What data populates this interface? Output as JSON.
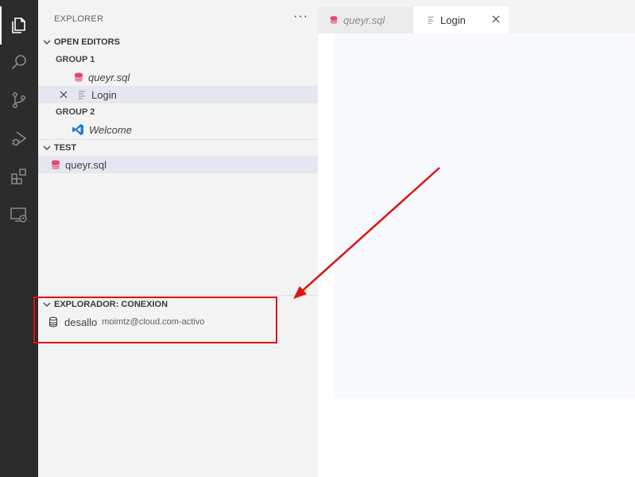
{
  "activity_bar": {
    "items": [
      {
        "name": "explorer",
        "icon": "files-icon",
        "active": true
      },
      {
        "name": "search",
        "icon": "search-icon"
      },
      {
        "name": "source-control",
        "icon": "source-control-icon"
      },
      {
        "name": "run-debug",
        "icon": "run-debug-icon"
      },
      {
        "name": "extensions",
        "icon": "extensions-icon"
      },
      {
        "name": "remote-explorer",
        "icon": "remote-explorer-icon"
      }
    ]
  },
  "sidebar": {
    "title": "EXPLORER",
    "more": "···",
    "open_editors": {
      "label": "OPEN EDITORS",
      "group1": {
        "label": "GROUP 1",
        "items": [
          {
            "label": "queyr.sql",
            "icon": "database-icon"
          },
          {
            "label": "Login",
            "icon": "file-text-icon"
          }
        ]
      },
      "group2": {
        "label": "GROUP 2",
        "items": [
          {
            "label": "Welcome",
            "icon": "vscode-logo-icon"
          }
        ]
      }
    },
    "test": {
      "label": "TEST",
      "items": [
        {
          "label": "queyr.sql",
          "icon": "database-icon"
        }
      ]
    },
    "conexion": {
      "label": "EXPLORADOR: CONEXION",
      "item_name": "desallo",
      "item_detail": "moimtz@cloud.com-activo",
      "item_icon": "database-outline-icon"
    }
  },
  "tabs": [
    {
      "label": "queyr.sql",
      "icon": "database-icon"
    },
    {
      "label": "Login",
      "icon": "file-text-icon",
      "active": true
    }
  ],
  "colors": {
    "activity_bg": "#2c2c2c",
    "sidebar_bg": "#f3f3f3",
    "selection": "#e4e6f1",
    "sql_icon": "#e04a6f",
    "vscode_blue": "#1e7bd6",
    "annotation_red": "#e01010"
  }
}
